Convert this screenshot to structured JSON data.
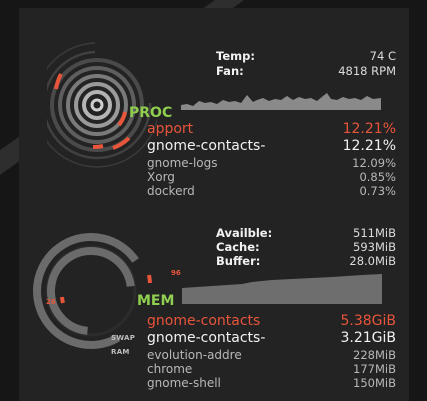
{
  "sensors": [
    {
      "label": "Temp:",
      "value": "74 C"
    },
    {
      "label": "Fan:",
      "value": "4818 RPM"
    }
  ],
  "proc": {
    "title": "PROC",
    "top": [
      {
        "name": "apport",
        "value": "12.21%"
      },
      {
        "name": "gnome-contacts-",
        "value": "12.21%"
      }
    ],
    "others": [
      {
        "name": "gnome-logs",
        "value": "12.09%"
      },
      {
        "name": "Xorg",
        "value": "0.85%"
      },
      {
        "name": "dockerd",
        "value": "0.73%"
      }
    ]
  },
  "mem": {
    "title": "MEM",
    "stats": [
      {
        "label": "Availble:",
        "value": "511MiB"
      },
      {
        "label": "Cache:",
        "value": "593MiB"
      },
      {
        "label": "Buffer:",
        "value": "28.0MiB"
      }
    ],
    "ring_labels": {
      "used_pct": "96",
      "swap_pct": "26",
      "swap": "SWAP",
      "ram": "RAM"
    },
    "top": [
      {
        "name": "gnome-contacts",
        "value": "5.38GiB"
      },
      {
        "name": "gnome-contacts-",
        "value": "3.21GiB"
      }
    ],
    "others": [
      {
        "name": "evolution-addre",
        "value": "228MiB"
      },
      {
        "name": "chrome",
        "value": "177MiB"
      },
      {
        "name": "gnome-shell",
        "value": "150MiB"
      }
    ]
  },
  "colors": {
    "accent_red": "#e8553a",
    "accent_green": "#8fce4f",
    "ring_gray": "#6b6b6b"
  }
}
